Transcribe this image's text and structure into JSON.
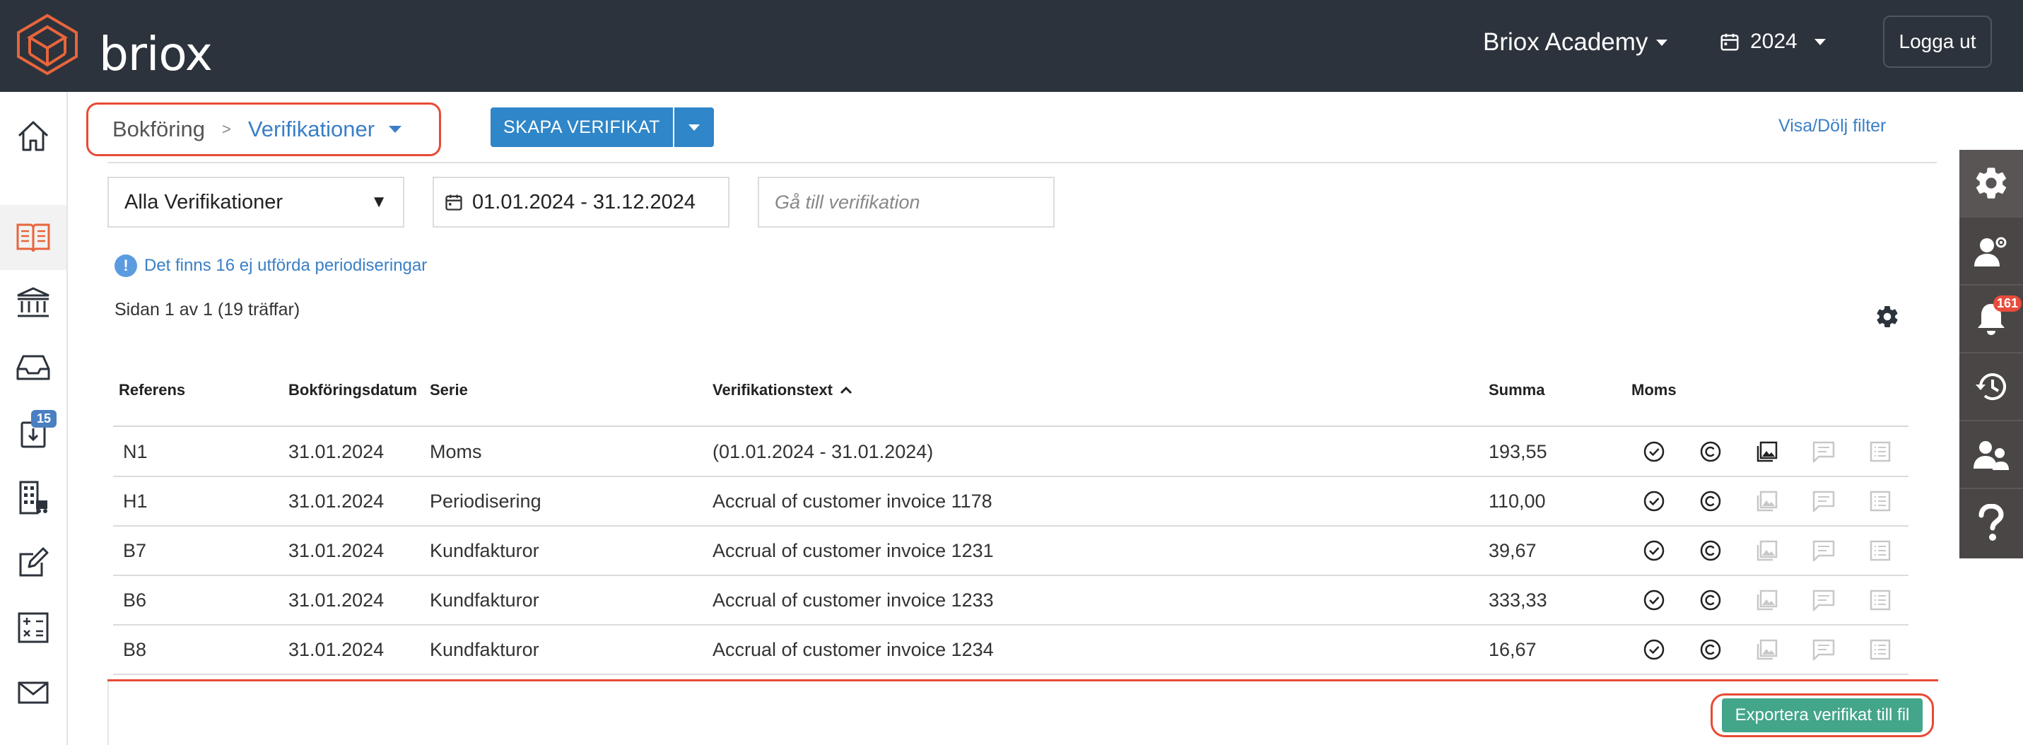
{
  "header": {
    "logo_text": "briox",
    "company": "Briox Academy",
    "year": "2024",
    "logout": "Logga ut"
  },
  "sidebar": {
    "items": [
      {
        "icon": "home-icon"
      },
      {
        "icon": "book-icon"
      },
      {
        "icon": "bank-icon"
      },
      {
        "icon": "inbox-icon"
      },
      {
        "icon": "download-icon",
        "badge": "15"
      },
      {
        "icon": "building-icon"
      },
      {
        "icon": "edit-icon"
      },
      {
        "icon": "calculator-icon"
      },
      {
        "icon": "mail-icon"
      }
    ]
  },
  "right_panel": {
    "items": [
      "gear-icon",
      "user-settings-icon",
      "bell-icon",
      "history-icon",
      "users-icon",
      "help-icon"
    ],
    "notification_count": "161"
  },
  "breadcrumb": {
    "parent": "Bokföring",
    "separator": ">",
    "current": "Verifikationer"
  },
  "toolbar": {
    "create_label": "SKAPA VERIFIKAT",
    "filter_toggle": "Visa/Dölj filter"
  },
  "filters": {
    "type_value": "Alla Verifikationer",
    "date_range": "01.01.2024 - 31.12.2024",
    "goto_placeholder": "Gå till verifikation"
  },
  "info_message": "Det finns 16 ej utförda periodiseringar",
  "pagination": "Sidan 1 av 1  (19 träffar)",
  "table": {
    "headers": {
      "ref": "Referens",
      "date": "Bokföringsdatum",
      "series": "Serie",
      "text": "Verifikationstext",
      "sum": "Summa",
      "vat": "Moms"
    },
    "rows": [
      {
        "ref": "N1",
        "date": "31.01.2024",
        "series": "Moms",
        "text": "(01.01.2024 - 31.01.2024)",
        "sum": "193,55",
        "has_attachment": true
      },
      {
        "ref": "H1",
        "date": "31.01.2024",
        "series": "Periodisering",
        "text": "Accrual of customer invoice 1178",
        "sum": "110,00",
        "has_attachment": false
      },
      {
        "ref": "B7",
        "date": "31.01.2024",
        "series": "Kundfakturor",
        "text": "Accrual of customer invoice 1231",
        "sum": "39,67",
        "has_attachment": false
      },
      {
        "ref": "B6",
        "date": "31.01.2024",
        "series": "Kundfakturor",
        "text": "Accrual of customer invoice 1233",
        "sum": "333,33",
        "has_attachment": false
      },
      {
        "ref": "B8",
        "date": "31.01.2024",
        "series": "Kundfakturor",
        "text": "Accrual of customer invoice 1234",
        "sum": "16,67",
        "has_attachment": false
      }
    ]
  },
  "footer": {
    "export_label": "Exportera verifikat till fil"
  },
  "colors": {
    "topbar": "#2c333c",
    "accent_blue": "#3a7fc6",
    "highlight_red": "#e84a35",
    "export_green": "#43a58a"
  }
}
